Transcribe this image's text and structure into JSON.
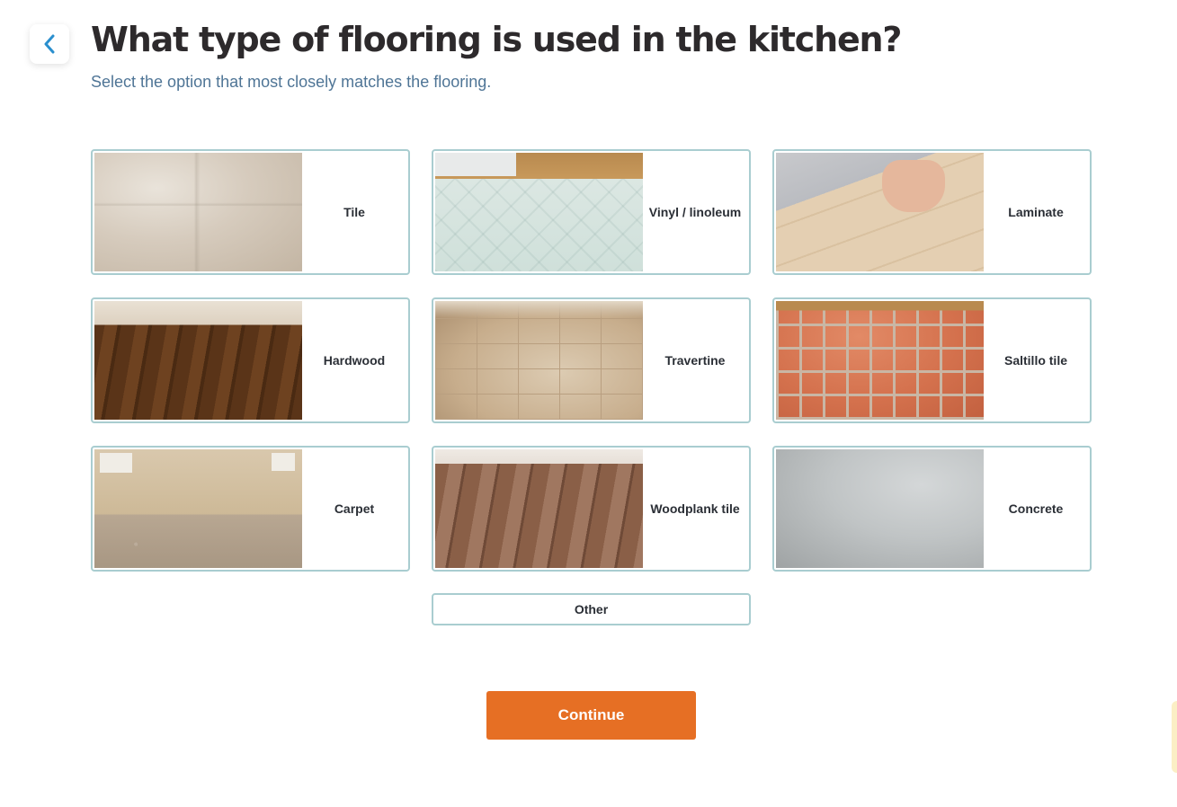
{
  "header": {
    "title": "What type of flooring is used in the kitchen?",
    "subtitle": "Select the option that most closely matches the flooring."
  },
  "back": {
    "icon": "chevron-left-icon",
    "color": "#2a8fce"
  },
  "options": [
    {
      "label": "Tile",
      "photo": "tile-floor-photo"
    },
    {
      "label": "Vinyl / linoleum",
      "photo": "vinyl-floor-photo"
    },
    {
      "label": "Laminate",
      "photo": "laminate-floor-photo"
    },
    {
      "label": "Hardwood",
      "photo": "hardwood-floor-photo"
    },
    {
      "label": "Travertine",
      "photo": "travertine-floor-photo"
    },
    {
      "label": "Saltillo tile",
      "photo": "saltillo-floor-photo"
    },
    {
      "label": "Carpet",
      "photo": "carpet-floor-photo"
    },
    {
      "label": "Woodplank tile",
      "photo": "woodplank-floor-photo"
    },
    {
      "label": "Concrete",
      "photo": "concrete-floor-photo"
    }
  ],
  "other": {
    "label": "Other"
  },
  "continue": {
    "label": "Continue",
    "color": "#e66f24"
  },
  "colors": {
    "card_border": "#a9cdd0",
    "title_text": "#2d2a2c",
    "subtitle_text": "#4f7596"
  }
}
